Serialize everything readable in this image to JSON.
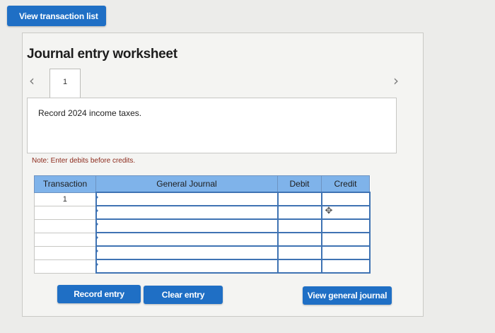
{
  "top_button": {
    "label": "View transaction list"
  },
  "worksheet": {
    "title": "Journal entry worksheet",
    "tabs": [
      {
        "label": "1",
        "active": true
      }
    ],
    "description": "Record 2024 income taxes.",
    "note": "Note: Enter debits before credits."
  },
  "table": {
    "headers": {
      "transaction": "Transaction",
      "general_journal": "General Journal",
      "debit": "Debit",
      "credit": "Credit"
    },
    "rows": [
      {
        "transaction": "1",
        "account": "",
        "debit": "",
        "credit": ""
      },
      {
        "transaction": "",
        "account": "",
        "debit": "",
        "credit": ""
      },
      {
        "transaction": "",
        "account": "",
        "debit": "",
        "credit": ""
      },
      {
        "transaction": "",
        "account": "",
        "debit": "",
        "credit": ""
      },
      {
        "transaction": "",
        "account": "",
        "debit": "",
        "credit": ""
      },
      {
        "transaction": "",
        "account": "",
        "debit": "",
        "credit": ""
      }
    ]
  },
  "actions": {
    "record_entry": "Record entry",
    "clear_entry": "Clear entry",
    "view_general_journal": "View general journal"
  },
  "icons": {
    "prev": "chevron-left-icon",
    "next": "chevron-right-icon",
    "mouse_cursor": "move-cursor-icon"
  },
  "colors": {
    "button_blue": "#1f6fc5",
    "table_header": "#7fb3ea",
    "input_border": "#3f73b3",
    "note_text": "#8c2a1c"
  }
}
